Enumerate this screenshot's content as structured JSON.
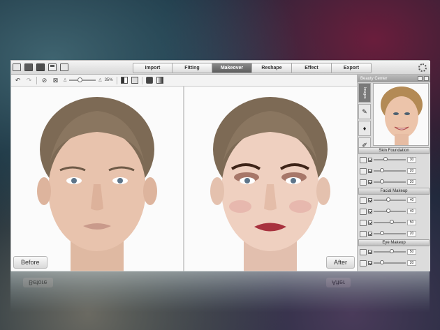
{
  "tabs": [
    {
      "label": "Import",
      "active": false
    },
    {
      "label": "Fitting",
      "active": false
    },
    {
      "label": "Makeover",
      "active": true
    },
    {
      "label": "Reshape",
      "active": false
    },
    {
      "label": "Effect",
      "active": false
    },
    {
      "label": "Export",
      "active": false
    }
  ],
  "toolbar": {
    "zoom_value": "35%"
  },
  "photos": {
    "before_label": "Before",
    "after_label": "After"
  },
  "side": {
    "title": "Beauty Center",
    "vtab_selected": "Images",
    "sections": [
      {
        "title": "Skin Foundation",
        "rows": [
          {
            "icon": "foundation-icon",
            "value": "30",
            "level": 0.3
          },
          {
            "icon": "blush-icon",
            "value": "20",
            "level": 0.2
          },
          {
            "icon": "contour-icon",
            "value": "20",
            "level": 0.2
          }
        ]
      },
      {
        "title": "Facial Makeup",
        "rows": [
          {
            "icon": "lipstick-icon",
            "value": "40",
            "level": 0.4
          },
          {
            "icon": "lip-liner-icon",
            "value": "40",
            "level": 0.4
          },
          {
            "icon": "lip-gloss-icon",
            "value": "50",
            "level": 0.5
          },
          {
            "icon": "teeth-icon",
            "value": "20",
            "level": 0.2
          }
        ]
      },
      {
        "title": "Eye Makeup",
        "rows": [
          {
            "icon": "eyeshadow-icon",
            "value": "50",
            "level": 0.5
          },
          {
            "icon": "eyeliner-icon",
            "value": "20",
            "level": 0.2
          }
        ]
      }
    ]
  },
  "colors": {
    "active_tab": "#6d6d6d",
    "lip_after": "#a8323e",
    "eyeshadow_after": "#6b2e20"
  }
}
